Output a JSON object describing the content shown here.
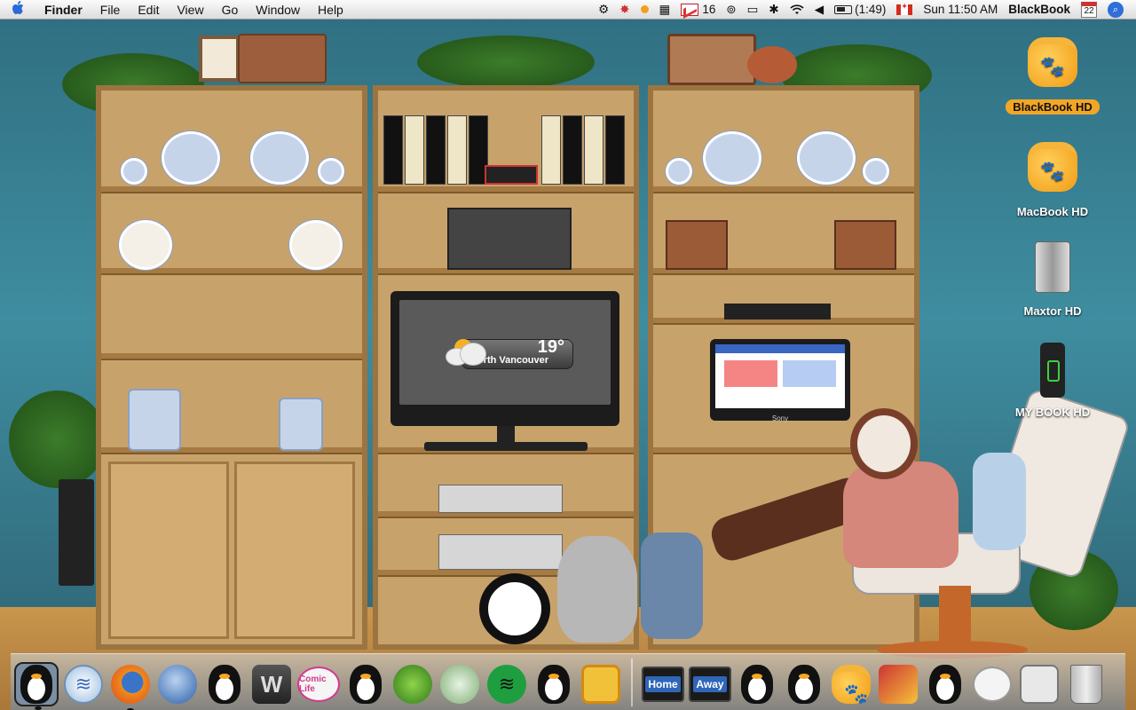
{
  "menubar": {
    "apple": "",
    "app_name": "Finder",
    "menus": [
      "File",
      "Edit",
      "View",
      "Go",
      "Window",
      "Help"
    ],
    "mail_count": "16",
    "battery": "(1:49)",
    "clock": "Sun 11:50 AM",
    "user": "BlackBook",
    "calendar_day": "22"
  },
  "desktop": {
    "weather_temp": "19°",
    "weather_city": "North Vancouver",
    "monitor_brand": "Sony",
    "icons": [
      {
        "label": "BlackBook HD",
        "selected": true,
        "type": "jar"
      },
      {
        "label": "MacBook HD",
        "selected": false,
        "type": "jar"
      },
      {
        "label": "Maxtor HD",
        "selected": false,
        "type": "silver-drive"
      },
      {
        "label": "MY BOOK HD",
        "selected": false,
        "type": "black-drive"
      }
    ]
  },
  "dock": {
    "home_label": "Home",
    "away_label": "Away",
    "comic_label": "Comic Life"
  },
  "colors": {
    "wall": "#3f8da0",
    "wood": "#c8a26b",
    "highlight": "#f3a626",
    "menubar": "#ececec"
  }
}
